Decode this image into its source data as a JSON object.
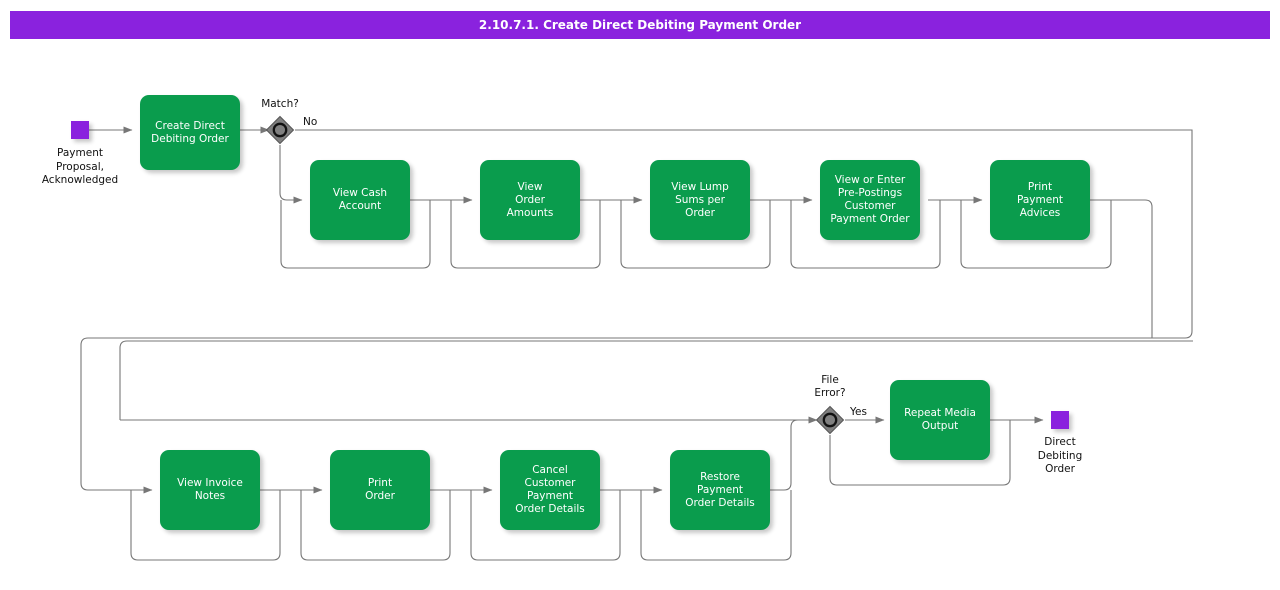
{
  "header": {
    "title": "2.10.7.1. Create Direct Debiting Payment Order",
    "bar_color": "#8A22DE"
  },
  "palette": {
    "task_green": "#0A9C4D",
    "event_purple": "#8A22DE",
    "gateway_gray": "#808080",
    "wire_gray": "#666666",
    "text_white": "#FFFFFF",
    "text_black": "#111111",
    "background": "#FFFFFF"
  },
  "start_event": {
    "name": "start-event",
    "label": "Payment\nProposal,\nAcknowledged"
  },
  "end_event": {
    "name": "end-event",
    "label": "Direct\nDebiting\nOrder"
  },
  "gateways": [
    {
      "id": "match",
      "label": "Match?",
      "outgoing_label": "No"
    },
    {
      "id": "file-error",
      "label": "File\nError?",
      "outgoing_label": "Yes"
    }
  ],
  "tasks": [
    {
      "id": "create-direct-debiting-order",
      "label": "Create Direct\nDebiting Order"
    },
    {
      "id": "view-cash-account",
      "label": "View Cash\nAccount"
    },
    {
      "id": "view-order-amounts",
      "label": "View\nOrder\nAmounts"
    },
    {
      "id": "view-lump-sums-per-order",
      "label": "View Lump\nSums per\nOrder"
    },
    {
      "id": "view-or-enter-pre-postings-customer-payment-order",
      "label": "View or Enter\nPre-Postings\nCustomer\nPayment Order"
    },
    {
      "id": "print-payment-advices",
      "label": "Print\nPayment\nAdvices"
    },
    {
      "id": "view-invoice-notes",
      "label": "View Invoice\nNotes"
    },
    {
      "id": "print-order",
      "label": "Print\nOrder"
    },
    {
      "id": "cancel-customer-payment-order-details",
      "label": "Cancel\nCustomer\nPayment\nOrder Details"
    },
    {
      "id": "restore-payment-order-details",
      "label": "Restore\nPayment\nOrder Details"
    },
    {
      "id": "repeat-media-output",
      "label": "Repeat Media\nOutput"
    }
  ]
}
